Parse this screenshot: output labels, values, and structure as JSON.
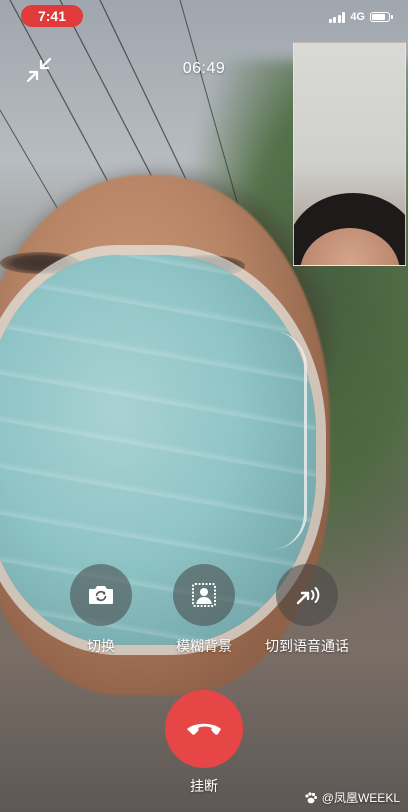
{
  "status_bar": {
    "time": "7:41",
    "network": "4G",
    "accent_color": "#e03a3a"
  },
  "call": {
    "timer": "06:49",
    "minimize_icon": "minimize-arrows-icon"
  },
  "controls": {
    "switch_camera": {
      "label": "切换",
      "icon": "camera-switch-icon"
    },
    "blur_background": {
      "label": "模糊背景",
      "icon": "portrait-blur-icon"
    },
    "switch_to_audio": {
      "label": "切到语音通话",
      "icon": "audio-call-icon"
    },
    "hangup": {
      "label": "挂断",
      "icon": "phone-hangup-icon",
      "color": "#e64646"
    }
  },
  "watermark": {
    "text": "@凤凰WEEKL",
    "icon": "paw-icon"
  }
}
